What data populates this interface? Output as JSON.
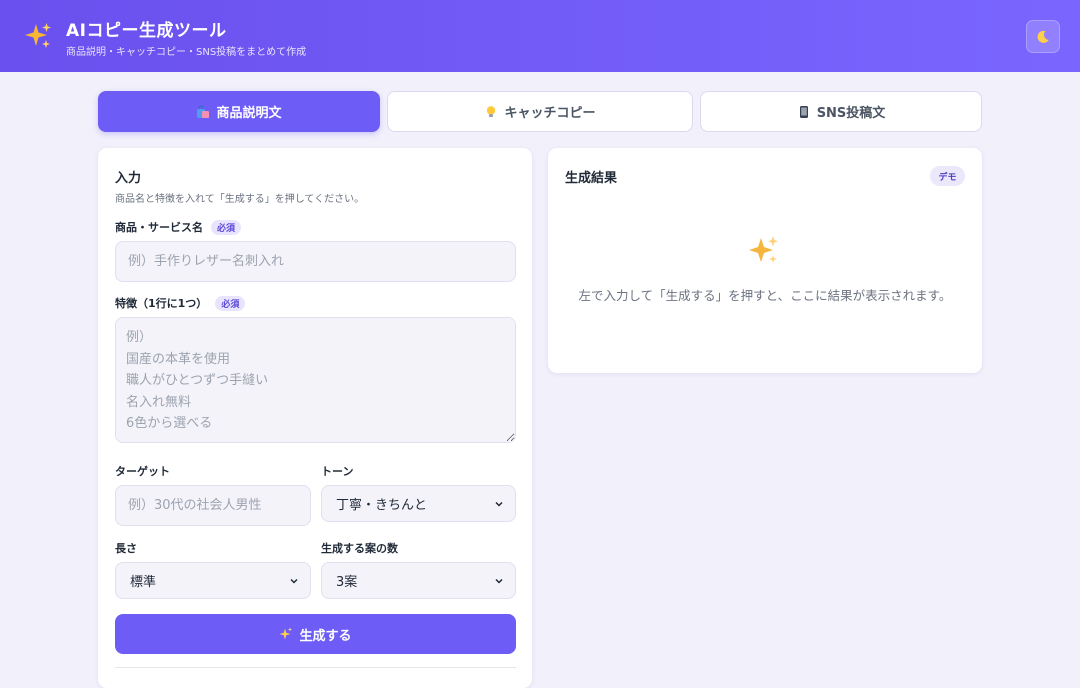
{
  "header": {
    "logo_icon": "sparkles-icon",
    "title": "AIコピー生成ツール",
    "subtitle": "商品説明・キャッチコピー・SNS投稿をまとめて作成",
    "theme_icon": "moon-icon"
  },
  "tabs": [
    {
      "label": "商品説明文",
      "icon": "shopping-bags-icon",
      "active": true
    },
    {
      "label": "キャッチコピー",
      "icon": "lightbulb-icon",
      "active": false
    },
    {
      "label": "SNS投稿文",
      "icon": "smartphone-icon",
      "active": false
    }
  ],
  "input_panel": {
    "title": "入力",
    "hint": "商品名と特徴を入れて「生成する」を押してください。",
    "product_name": {
      "label": "商品・サービス名",
      "badge": "必須",
      "placeholder": "例）手作りレザー名刺入れ",
      "value": ""
    },
    "features": {
      "label": "特徴（1行に1つ）",
      "badge": "必須",
      "placeholder": "例）\n国産の本革を使用\n職人がひとつずつ手縫い\n名入れ無料\n6色から選べる",
      "value": ""
    },
    "target": {
      "label": "ターゲット",
      "placeholder": "例）30代の社会人男性",
      "value": ""
    },
    "tone": {
      "label": "トーン",
      "selected": "丁寧・きちんと"
    },
    "length": {
      "label": "長さ",
      "selected": "標準"
    },
    "count": {
      "label": "生成する案の数",
      "selected": "3案"
    },
    "generate_button": "生成する",
    "generate_icon": "sparkles-icon"
  },
  "result_panel": {
    "title": "生成結果",
    "badge": "デモ",
    "empty_icon": "sparkles-icon",
    "empty_message": "左で入力して「生成する」を押すと、ここに結果が表示されます。"
  },
  "colors": {
    "accent": "#6d5cf6",
    "header_start": "#6a50ee",
    "header_end": "#7a66ff",
    "background": "#f1f0fb",
    "sparkle": "#f5b53f"
  }
}
